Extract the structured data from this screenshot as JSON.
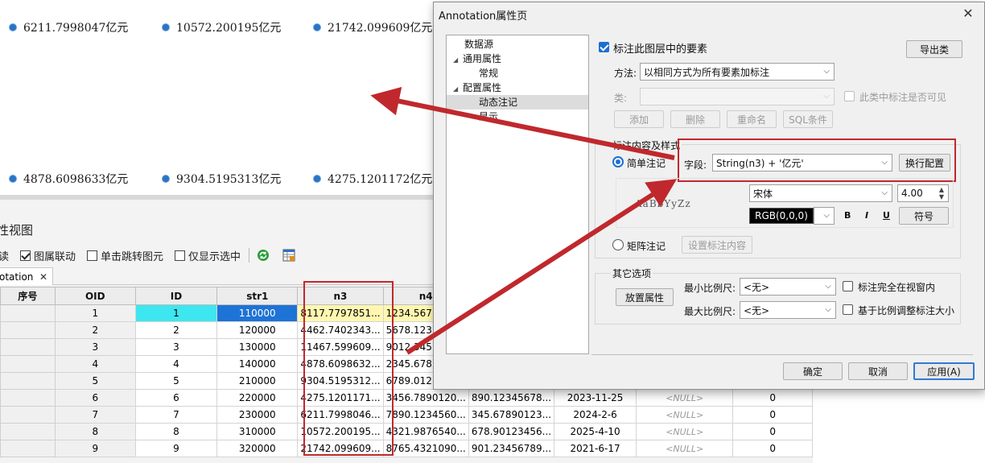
{
  "map": {
    "labels": [
      "6211.7998047亿元",
      "10572.200195亿元",
      "21742.099609亿元",
      "4878.6098633亿元",
      "9304.5195313亿元",
      "4275.1201172亿元"
    ]
  },
  "panel": {
    "title": "性视图",
    "toolbar": {
      "readonly": "读",
      "link_label": "图属联动",
      "jump_label": "单击跳转图元",
      "only_selected_label": "仅显示选中"
    },
    "tab_label": "otation",
    "columns": [
      "序号",
      "OID",
      "ID",
      "str1",
      "n3",
      "n4",
      "",
      "",
      "",
      ""
    ],
    "rows": [
      {
        "oid": "1",
        "id": "1",
        "str1": "110000",
        "n3": "8117.7797851...",
        "n4": "1234.567...",
        "c6": "",
        "c7": "",
        "c8": "",
        "c9": ""
      },
      {
        "oid": "2",
        "id": "2",
        "str1": "120000",
        "n3": "4462.7402343...",
        "n4": "5678.123...",
        "c6": "",
        "c7": "",
        "c8": "",
        "c9": ""
      },
      {
        "oid": "3",
        "id": "3",
        "str1": "130000",
        "n3": "11467.599609...",
        "n4": "9012.345...",
        "c6": "",
        "c7": "",
        "c8": "",
        "c9": ""
      },
      {
        "oid": "4",
        "id": "4",
        "str1": "140000",
        "n3": "4878.6098632...",
        "n4": "2345.678...",
        "c6": "",
        "c7": "",
        "c8": "",
        "c9": ""
      },
      {
        "oid": "5",
        "id": "5",
        "str1": "210000",
        "n3": "9304.5195312...",
        "n4": "6789.012...",
        "c6": "",
        "c7": "",
        "c8": "",
        "c9": ""
      },
      {
        "oid": "6",
        "id": "6",
        "str1": "220000",
        "n3": "4275.1201171...",
        "n4": "3456.7890120...",
        "c6": "890.12345678...",
        "c7": "2023-11-25",
        "c8": "<NULL>",
        "c9": "0"
      },
      {
        "oid": "7",
        "id": "7",
        "str1": "230000",
        "n3": "6211.7998046...",
        "n4": "7890.1234560...",
        "c6": "345.67890123...",
        "c7": "2024-2-6",
        "c8": "<NULL>",
        "c9": "0"
      },
      {
        "oid": "8",
        "id": "8",
        "str1": "310000",
        "n3": "10572.200195...",
        "n4": "4321.9876540...",
        "c6": "678.90123456...",
        "c7": "2025-4-10",
        "c8": "<NULL>",
        "c9": "0"
      },
      {
        "oid": "9",
        "id": "9",
        "str1": "320000",
        "n3": "21742.099609...",
        "n4": "8765.4321090...",
        "c6": "901.23456789...",
        "c7": "2021-6-17",
        "c8": "<NULL>",
        "c9": "0"
      }
    ]
  },
  "dialog": {
    "title": "Annotation属性页",
    "close": "✕",
    "tree": {
      "items": [
        "数据源",
        "通用属性",
        "常规",
        "配置属性",
        "动态注记",
        "显示"
      ]
    },
    "label_features": "标注此图层中的要素",
    "export_class": "导出类",
    "method_label": "方法:",
    "method_value": "以相同方式为所有要素加标注",
    "class_label": "类:",
    "class_value": "",
    "class_visible": "此类中标注是否可见",
    "add": "添加",
    "delete": "删除",
    "rename": "重命名",
    "sql": "SQL条件",
    "content_group": "标注内容及样式",
    "simple_label": "简单注记",
    "field_label": "字段:",
    "field_value": "String(n3) + '亿元'",
    "wrap_config": "换行配置",
    "preview_text": "AaBbYyZz",
    "font_value": "宋体",
    "size_value": "4.00",
    "color_value": "RGB(0,0,0)",
    "bold": "B",
    "italic": "I",
    "underline": "U",
    "symbol": "符号",
    "matrix_label": "矩阵注记",
    "set_content": "设置标注内容",
    "other_group": "其它选项",
    "placement": "放置属性",
    "min_scale_label": "最小比例尺:",
    "min_scale_value": "<无>",
    "max_scale_label": "最大比例尺:",
    "max_scale_value": "<无>",
    "fully_in_view": "标注完全在视窗内",
    "scale_size": "基于比例调整标注大小",
    "ok": "确定",
    "cancel": "取消",
    "apply": "应用(A)"
  },
  "colors": {
    "annotation_red": "#c0282d",
    "dot_blue": "#2a74c4",
    "selected_blue": "#1e73d6",
    "selected_cyan": "#3ee6ef"
  }
}
